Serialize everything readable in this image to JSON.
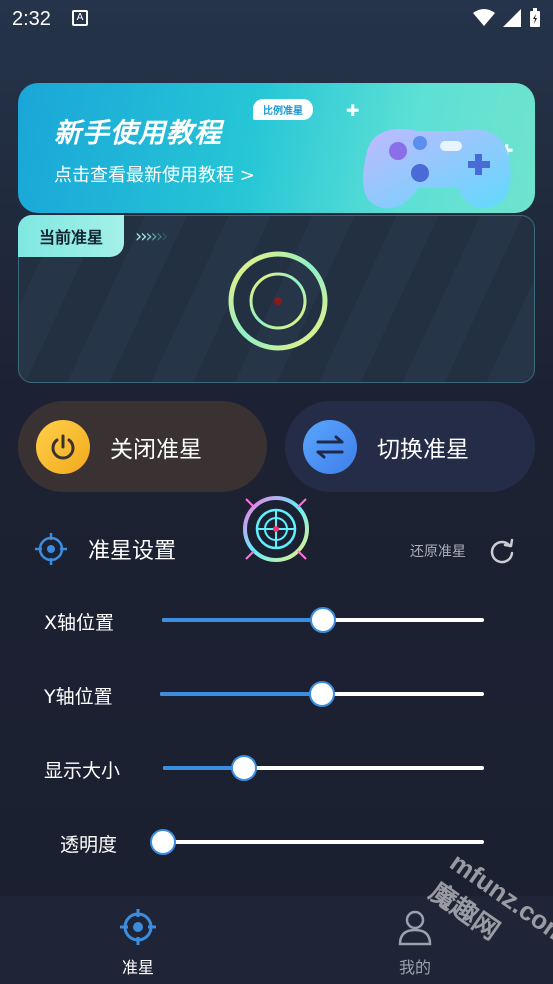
{
  "status_bar": {
    "time": "2:32",
    "notif": "A"
  },
  "banner": {
    "title": "新手使用教程",
    "subtitle": "点击查看最新使用教程 >",
    "tag": "比例准星"
  },
  "current_card": {
    "tab_label": "当前准星",
    "chevrons": ">>>>>>"
  },
  "actions": {
    "close_label": "关闭准星",
    "switch_label": "切换准星"
  },
  "settings": {
    "title": "准星设置",
    "reset_label": "还原准星",
    "sliders": [
      {
        "label": "X轴位置",
        "value": 0.5
      },
      {
        "label": "Y轴位置",
        "value": 0.5
      },
      {
        "label": "显示大小",
        "value": 0.25
      },
      {
        "label": "透明度",
        "value": 0.0
      }
    ]
  },
  "bottom_nav": {
    "items": [
      {
        "label": "准星",
        "icon": "crosshair-icon",
        "active": true
      },
      {
        "label": "我的",
        "icon": "user-icon",
        "active": false
      }
    ]
  },
  "watermark": "mfunz.com 魔趣网",
  "colors": {
    "accent": "#3a8ddf",
    "tab": "#7fe8e0",
    "close": "#f2a91d",
    "switch": "#3e7ee8"
  }
}
